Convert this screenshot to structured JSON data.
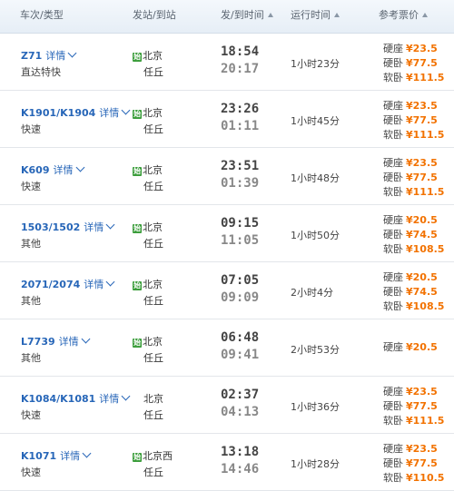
{
  "header": {
    "col_train": "车次/类型",
    "col_station": "发站/到站",
    "col_time": "发/到时间",
    "col_duration": "运行时间",
    "col_price": "参考票价"
  },
  "start_badge": "始",
  "detail_label": "详情",
  "rows": [
    {
      "train": "Z71",
      "type": "直达特快",
      "start": true,
      "from": "北京",
      "to": "任丘",
      "dep": "18:54",
      "arr": "20:17",
      "duration": "1小时23分",
      "prices": [
        {
          "label": "硬座",
          "amount": "¥23.5"
        },
        {
          "label": "硬卧",
          "amount": "¥77.5"
        },
        {
          "label": "软卧",
          "amount": "¥111.5"
        }
      ]
    },
    {
      "train": "K1901/K1904",
      "type": "快速",
      "start": true,
      "from": "北京",
      "to": "任丘",
      "dep": "23:26",
      "arr": "01:11",
      "duration": "1小时45分",
      "prices": [
        {
          "label": "硬座",
          "amount": "¥23.5"
        },
        {
          "label": "硬卧",
          "amount": "¥77.5"
        },
        {
          "label": "软卧",
          "amount": "¥111.5"
        }
      ]
    },
    {
      "train": "K609",
      "type": "快速",
      "start": true,
      "from": "北京",
      "to": "任丘",
      "dep": "23:51",
      "arr": "01:39",
      "duration": "1小时48分",
      "prices": [
        {
          "label": "硬座",
          "amount": "¥23.5"
        },
        {
          "label": "硬卧",
          "amount": "¥77.5"
        },
        {
          "label": "软卧",
          "amount": "¥111.5"
        }
      ]
    },
    {
      "train": "1503/1502",
      "type": "其他",
      "start": true,
      "from": "北京",
      "to": "任丘",
      "dep": "09:15",
      "arr": "11:05",
      "duration": "1小时50分",
      "prices": [
        {
          "label": "硬座",
          "amount": "¥20.5"
        },
        {
          "label": "硬卧",
          "amount": "¥74.5"
        },
        {
          "label": "软卧",
          "amount": "¥108.5"
        }
      ]
    },
    {
      "train": "2071/2074",
      "type": "其他",
      "start": true,
      "from": "北京",
      "to": "任丘",
      "dep": "07:05",
      "arr": "09:09",
      "duration": "2小时4分",
      "prices": [
        {
          "label": "硬座",
          "amount": "¥20.5"
        },
        {
          "label": "硬卧",
          "amount": "¥74.5"
        },
        {
          "label": "软卧",
          "amount": "¥108.5"
        }
      ]
    },
    {
      "train": "L7739",
      "type": "其他",
      "start": true,
      "from": "北京",
      "to": "任丘",
      "dep": "06:48",
      "arr": "09:41",
      "duration": "2小时53分",
      "prices": [
        {
          "label": "硬座",
          "amount": "¥20.5"
        }
      ]
    },
    {
      "train": "K1084/K1081",
      "type": "快速",
      "start": false,
      "from": "北京",
      "to": "任丘",
      "dep": "02:37",
      "arr": "04:13",
      "duration": "1小时36分",
      "prices": [
        {
          "label": "硬座",
          "amount": "¥23.5"
        },
        {
          "label": "硬卧",
          "amount": "¥77.5"
        },
        {
          "label": "软卧",
          "amount": "¥111.5"
        }
      ]
    },
    {
      "train": "K1071",
      "type": "快速",
      "start": true,
      "from": "北京西",
      "to": "任丘",
      "dep": "13:18",
      "arr": "14:46",
      "duration": "1小时28分",
      "prices": [
        {
          "label": "硬座",
          "amount": "¥23.5"
        },
        {
          "label": "硬卧",
          "amount": "¥77.5"
        },
        {
          "label": "软卧",
          "amount": "¥110.5"
        }
      ]
    }
  ],
  "colors": {
    "link": "#2766b8",
    "price": "#f27200",
    "badge": "#3a9d3a"
  }
}
